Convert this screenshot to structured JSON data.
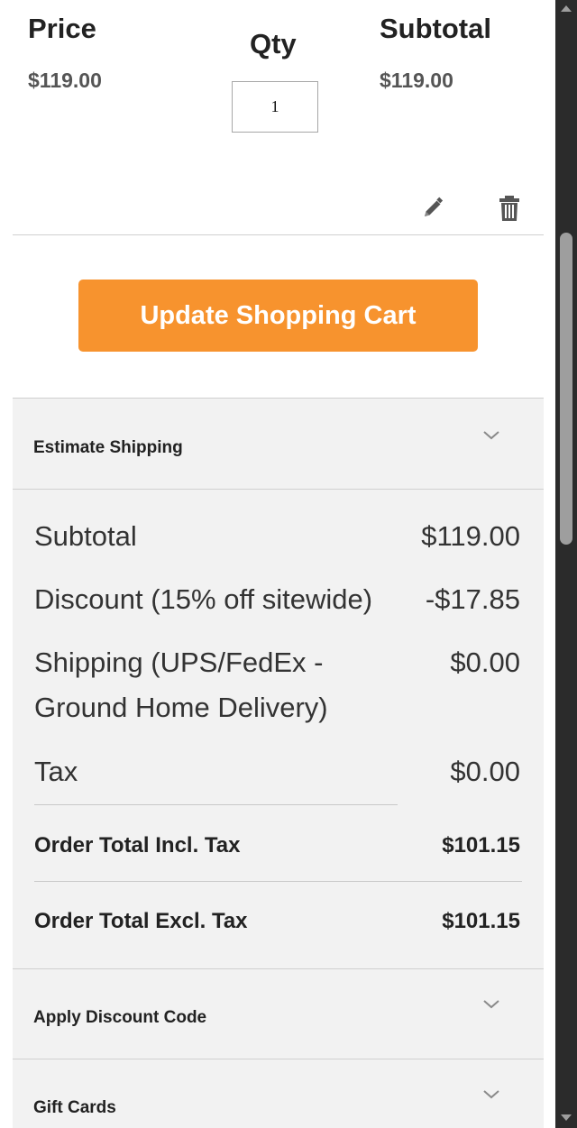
{
  "cart_item": {
    "price_header": "Price",
    "qty_header": "Qty",
    "subtotal_header": "Subtotal",
    "price": "$119.00",
    "qty": "1",
    "subtotal": "$119.00",
    "edit_icon": "pencil-icon",
    "delete_icon": "trash-icon"
  },
  "update_button_label": "Update Shopping Cart",
  "accent_color": "#f7932e",
  "estimate_shipping": {
    "title": "Estimate Shipping",
    "icon": "chevron-down-icon"
  },
  "totals": {
    "subtotal_label": "Subtotal",
    "subtotal_value": "$119.00",
    "discount_label": "Discount (15% off sitewide)",
    "discount_value": "-$17.85",
    "shipping_label_line1": "Shipping (UPS/FedEx -",
    "shipping_label_line2": "Ground Home Delivery)",
    "shipping_value": "$0.00",
    "tax_label": "Tax",
    "tax_value": "$0.00",
    "order_total_incl_label": "Order Total Incl. Tax",
    "order_total_incl_value": "$101.15",
    "order_total_excl_label": "Order Total Excl. Tax",
    "order_total_excl_value": "$101.15"
  },
  "apply_discount": {
    "title": "Apply Discount Code",
    "icon": "chevron-down-icon"
  },
  "gift_cards": {
    "title": "Gift Cards",
    "icon": "chevron-down-icon"
  }
}
